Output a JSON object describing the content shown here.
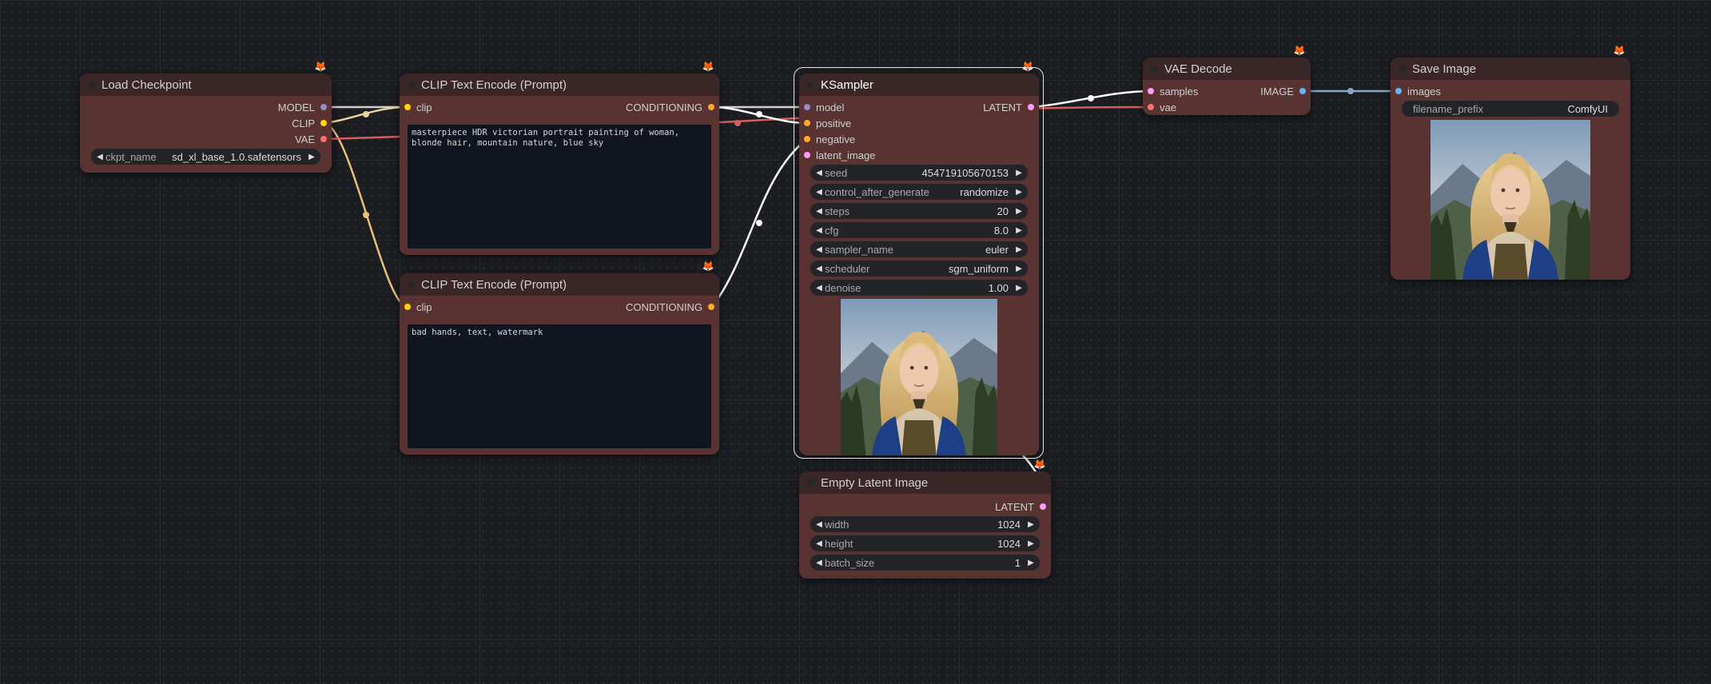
{
  "colors": {
    "model": "#b39ddb",
    "clip": "#ffd500",
    "vae": "#ff6e6e",
    "conditioning": "#ffa931",
    "latent": "#ff9cf9",
    "image": "#64b5f6",
    "node_body": "#593232",
    "node_title": "#3a2626",
    "badge_icon": "fox-badge-icon"
  },
  "nodes": {
    "load_checkpoint": {
      "title": "Load Checkpoint",
      "outputs": [
        "MODEL",
        "CLIP",
        "VAE"
      ],
      "widget": {
        "label": "ckpt_name",
        "value": "sd_xl_base_1.0.safetensors"
      }
    },
    "clip_positive": {
      "title": "CLIP Text Encode (Prompt)",
      "input": "clip",
      "output": "CONDITIONING",
      "text": "masterpiece HDR victorian portrait painting of woman, blonde hair, mountain nature, blue sky"
    },
    "clip_negative": {
      "title": "CLIP Text Encode (Prompt)",
      "input": "clip",
      "output": "CONDITIONING",
      "text": "bad hands, text, watermark"
    },
    "ksampler": {
      "title": "KSampler",
      "inputs": [
        "model",
        "positive",
        "negative",
        "latent_image"
      ],
      "output": "LATENT",
      "widgets": [
        {
          "label": "seed",
          "value": "454719105670153"
        },
        {
          "label": "control_after_generate",
          "value": "randomize"
        },
        {
          "label": "steps",
          "value": "20"
        },
        {
          "label": "cfg",
          "value": "8.0"
        },
        {
          "label": "sampler_name",
          "value": "euler"
        },
        {
          "label": "scheduler",
          "value": "sgm_uniform"
        },
        {
          "label": "denoise",
          "value": "1.00"
        }
      ]
    },
    "vae_decode": {
      "title": "VAE Decode",
      "inputs": [
        "samples",
        "vae"
      ],
      "output": "IMAGE"
    },
    "save_image": {
      "title": "Save Image",
      "input": "images",
      "widget": {
        "label": "filename_prefix",
        "value": "ComfyUI"
      }
    },
    "empty_latent": {
      "title": "Empty Latent Image",
      "output": "LATENT",
      "widgets": [
        {
          "label": "width",
          "value": "1024"
        },
        {
          "label": "height",
          "value": "1024"
        },
        {
          "label": "batch_size",
          "value": "1"
        }
      ]
    }
  }
}
